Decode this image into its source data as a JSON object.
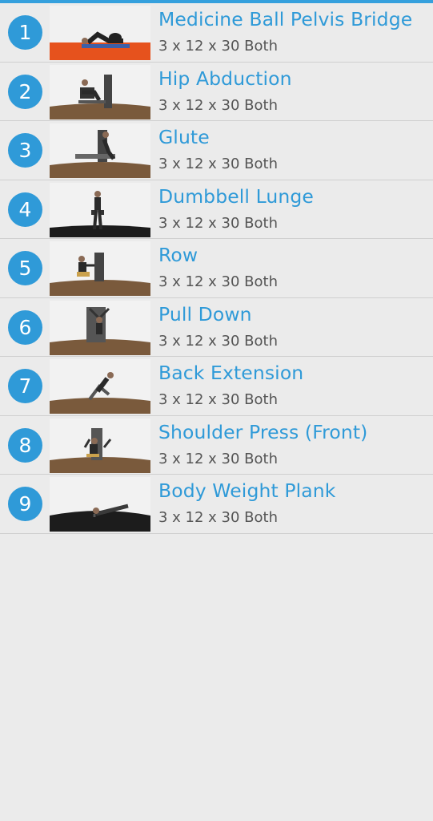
{
  "exercises": [
    {
      "number": "1",
      "name": "Medicine Ball Pelvis Bridge",
      "prescription": "3 x 12 x 30 Both",
      "floor": "#e6521d",
      "icon": "bridge-exercise-image"
    },
    {
      "number": "2",
      "name": "Hip Abduction",
      "prescription": "3 x 12 x 30 Both",
      "floor": "#7a5a3c",
      "icon": "hip-abduction-machine-image"
    },
    {
      "number": "3",
      "name": "Glute",
      "prescription": "3 x 12 x 30 Both",
      "floor": "#7a5a3c",
      "icon": "glute-machine-image"
    },
    {
      "number": "4",
      "name": "Dumbbell Lunge",
      "prescription": "3 x 12 x 30 Both",
      "floor": "#1c1c1c",
      "icon": "dumbbell-lunge-image"
    },
    {
      "number": "5",
      "name": "Row",
      "prescription": "3 x 12 x 30 Both",
      "floor": "#7a5a3c",
      "icon": "row-machine-image"
    },
    {
      "number": "6",
      "name": "Pull Down",
      "prescription": "3 x 12 x 30 Both",
      "floor": "#7a5a3c",
      "icon": "pull-down-machine-image"
    },
    {
      "number": "7",
      "name": "Back Extension",
      "prescription": "3 x 12 x 30 Both",
      "floor": "#7a5a3c",
      "icon": "back-extension-image"
    },
    {
      "number": "8",
      "name": "Shoulder Press (Front)",
      "prescription": "3 x 12 x 30 Both",
      "floor": "#7a5a3c",
      "icon": "shoulder-press-machine-image"
    },
    {
      "number": "9",
      "name": "Body Weight Plank",
      "prescription": "3 x 12 x 30 Both",
      "floor": "#1c1c1c",
      "icon": "plank-exercise-image"
    }
  ],
  "theme": {
    "accent": "#2f9ad8",
    "top_bar": "#35a0dd",
    "background": "#ebebeb"
  }
}
